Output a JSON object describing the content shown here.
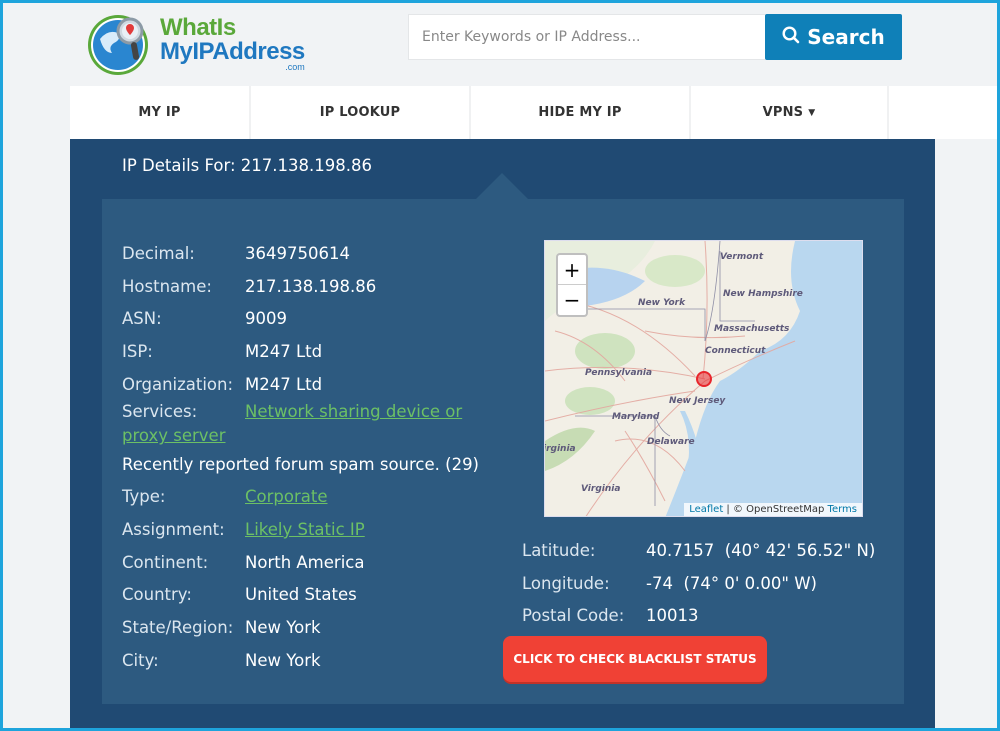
{
  "header": {
    "logo": {
      "line1": "WhatIs",
      "line2": "MyIPAddress",
      "suffix": ".com"
    },
    "search": {
      "placeholder": "Enter Keywords or IP Address...",
      "value": "",
      "button_label": "Search",
      "button_icon": "search-icon"
    }
  },
  "nav": {
    "items": [
      {
        "label": "MY IP"
      },
      {
        "label": "IP LOOKUP"
      },
      {
        "label": "HIDE MY IP"
      },
      {
        "label": "VPNS",
        "icon": "caret-down-icon",
        "caret": "▼"
      },
      {
        "label": ""
      }
    ]
  },
  "main": {
    "title": "IP Details For: 217.138.198.86",
    "details": [
      {
        "label": "Decimal:",
        "value": "3649750614"
      },
      {
        "label": "Hostname:",
        "value": "217.138.198.86"
      },
      {
        "label": "ASN:",
        "value": "9009"
      },
      {
        "label": "ISP:",
        "value": "M247 Ltd"
      },
      {
        "label": "Organization:",
        "value": "M247 Ltd"
      }
    ],
    "services": {
      "label": "Services:",
      "value": "Network sharing device or proxy server"
    },
    "spam_note": "Recently reported forum spam source. (29)",
    "details2": [
      {
        "label": "Type:",
        "value": "Corporate",
        "link": true
      },
      {
        "label": "Assignment:",
        "value": "Likely Static IP",
        "link": true
      },
      {
        "label": "Continent:",
        "value": "North America"
      },
      {
        "label": "Country:",
        "value": "United States"
      },
      {
        "label": "State/Region:",
        "value": "New York"
      },
      {
        "label": "City:",
        "value": "New York"
      }
    ],
    "map": {
      "zoom_in": "+",
      "zoom_out": "−",
      "labels": [
        "Vermont",
        "New Hampshire",
        "New York",
        "Massachusetts",
        "Connecticut",
        "Pennsylvania",
        "New Jersey",
        "Maryland",
        "Delaware",
        "Virginia",
        "irginia"
      ],
      "attribution": {
        "leaflet": "Leaflet",
        "separator": " | © OpenStreetMap ",
        "terms": "Terms"
      },
      "marker_color": "#e8262c"
    },
    "coordinates": [
      {
        "label": "Latitude:",
        "value": "40.7157  (40° 42' 56.52\" N)"
      },
      {
        "label": "Longitude:",
        "value": "-74  (74° 0' 0.00\" W)"
      },
      {
        "label": "Postal Code:",
        "value": "10013"
      }
    ],
    "blacklist_button": "CLICK TO CHECK BLACKLIST STATUS"
  },
  "colors": {
    "accent": "#0f80b8",
    "panel_dark": "#204a73",
    "panel_inner": "#2d5a80",
    "link": "#6cc065",
    "alert": "#f04135"
  }
}
